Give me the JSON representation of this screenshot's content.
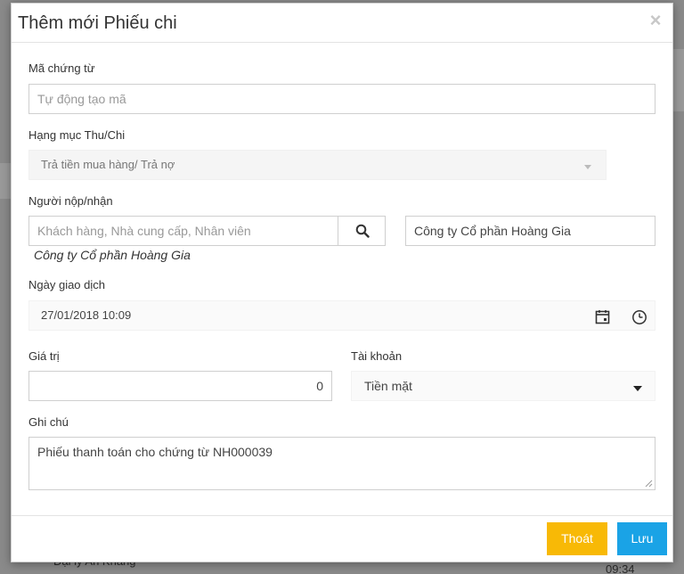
{
  "background": {
    "bottom_text": "Đại lý An Khang",
    "bottom_time": "09:34"
  },
  "modal": {
    "title": "Thêm mới Phiếu chi",
    "close_symbol": "×"
  },
  "form": {
    "voucher_code": {
      "label": "Mã chứng từ",
      "placeholder": "Tự động tạo mã"
    },
    "category": {
      "label": "Hạng mục Thu/Chi",
      "value": "Trả tiền mua hàng/ Trả nợ"
    },
    "payer": {
      "label": "Người nộp/nhận",
      "search_placeholder": "Khách hàng, Nhà cung cấp, Nhân viên",
      "selected_name": "Công ty Cổ phần Hoàng Gia",
      "selected_note": "Công ty Cổ phần Hoàng Gia"
    },
    "transaction_date": {
      "label": "Ngày giao dịch",
      "value": "27/01/2018 10:09"
    },
    "amount": {
      "label": "Giá trị",
      "value": "0"
    },
    "account": {
      "label": "Tài khoản",
      "value": "Tiền mặt"
    },
    "note": {
      "label": "Ghi chú",
      "value": "Phiếu thanh toán cho chứng từ NH000039"
    }
  },
  "footer": {
    "exit_label": "Thoát",
    "save_label": "Lưu"
  },
  "colors": {
    "exit_button": "#f8b906",
    "save_button": "#1aa3e6"
  },
  "icons": [
    "close-icon",
    "search-icon",
    "calendar-icon",
    "clock-icon",
    "caret-down-icon"
  ]
}
